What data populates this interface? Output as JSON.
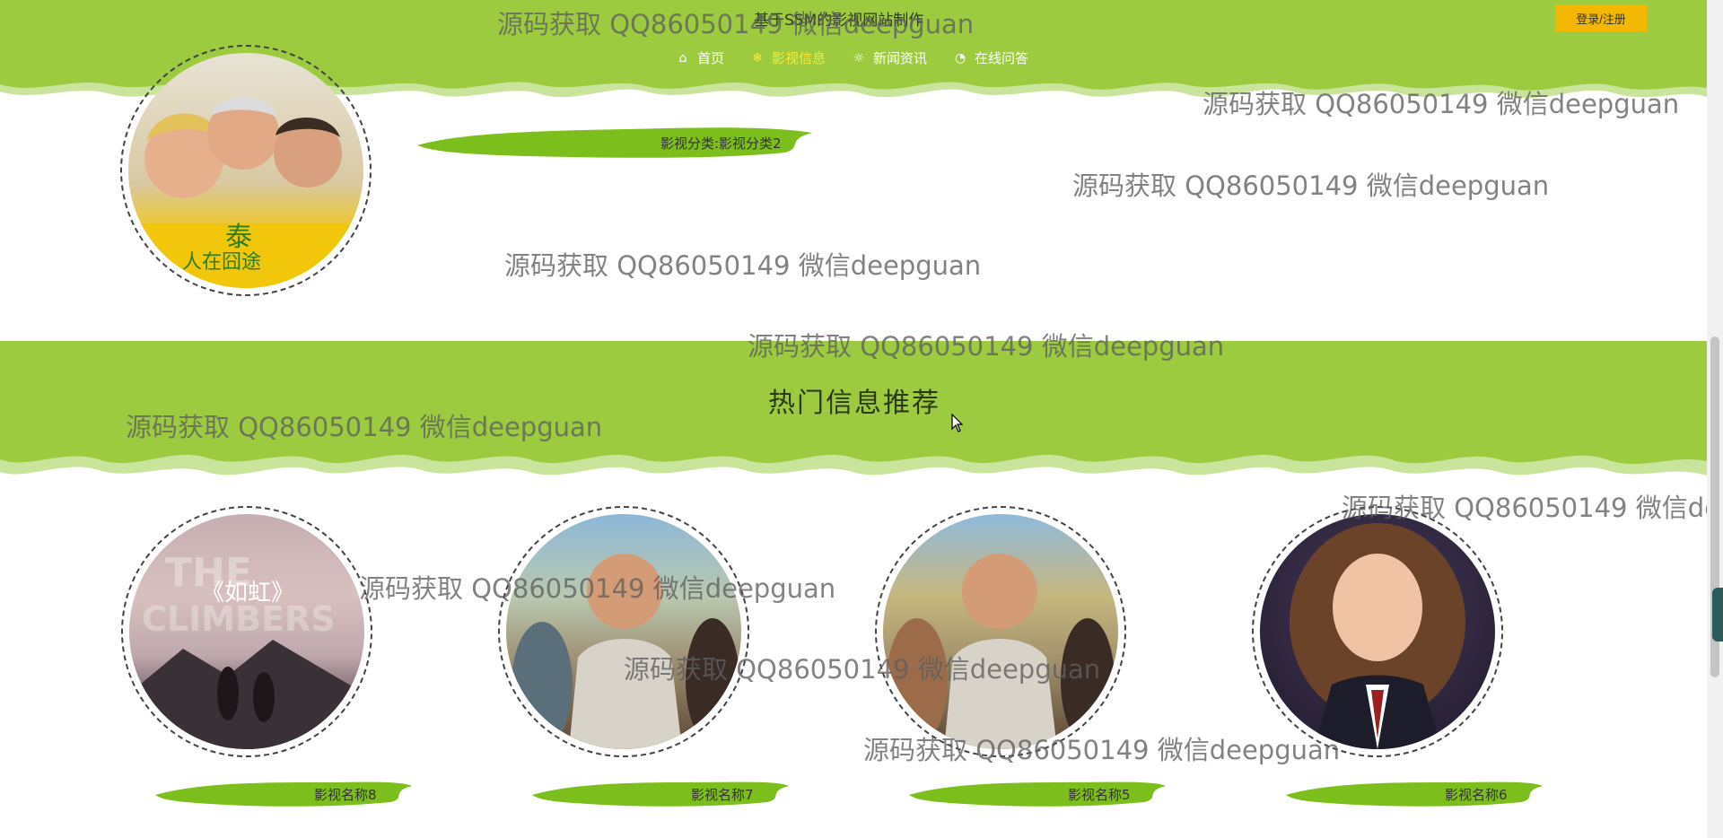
{
  "site": {
    "title": "基于SSM的影视网站制作"
  },
  "header": {
    "login_label": "登录/注册",
    "nav": [
      {
        "icon": "home-icon",
        "label": "首页",
        "active": false
      },
      {
        "icon": "snowflake-icon",
        "label": "影视信息",
        "active": true
      },
      {
        "icon": "gear-icon",
        "label": "新闻资讯",
        "active": false
      },
      {
        "icon": "chat-icon",
        "label": "在线问答",
        "active": false
      }
    ]
  },
  "category_item": {
    "label": "影视分类:影视分类2"
  },
  "hot": {
    "title": "热门信息推荐",
    "items": [
      {
        "name": "影视名称8"
      },
      {
        "name": "影视名称7"
      },
      {
        "name": "影视名称5"
      },
      {
        "name": "影视名称6"
      }
    ]
  },
  "poster_text": {
    "climbers_title": "《如虹》",
    "climbers_bg": "THE CLIMBERS"
  },
  "watermark": "源码获取 QQ86050149 微信deepguan",
  "colors": {
    "green": "#9ccb3f",
    "light_green": "#c9e49b",
    "brush": "#7cbf1c",
    "login": "#f5b800",
    "nav_active": "#f6ea3c"
  }
}
